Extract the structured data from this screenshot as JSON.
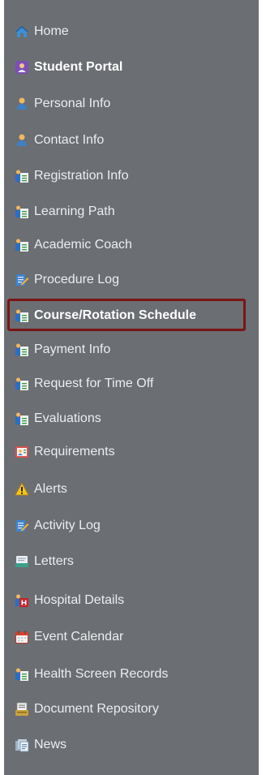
{
  "nav": {
    "items": [
      {
        "label": "Home",
        "icon": "home-icon"
      },
      {
        "label": "Student Portal",
        "icon": "student-portal-icon",
        "bold": true
      },
      {
        "label": "Personal Info",
        "icon": "person-icon"
      },
      {
        "label": "Contact Info",
        "icon": "person-icon"
      },
      {
        "label": "Registration Info",
        "icon": "clipboard-person-icon"
      },
      {
        "label": "Learning Path",
        "icon": "clipboard-person-icon"
      },
      {
        "label": "Academic Coach",
        "icon": "clipboard-person-icon"
      },
      {
        "label": "Procedure Log",
        "icon": "notepad-pencil-icon"
      },
      {
        "label": "Course/Rotation Schedule",
        "icon": "clipboard-person-icon",
        "bold": true,
        "selected": true
      },
      {
        "label": "Payment Info",
        "icon": "clipboard-person-icon"
      },
      {
        "label": "Request for Time Off",
        "icon": "clipboard-person-icon"
      },
      {
        "label": "Evaluations",
        "icon": "clipboard-person-icon"
      },
      {
        "label": "Requirements",
        "icon": "requirements-icon"
      },
      {
        "label": "Alerts",
        "icon": "warning-icon"
      },
      {
        "label": "Activity Log",
        "icon": "notepad-pencil-icon"
      },
      {
        "label": "Letters",
        "icon": "letter-icon"
      },
      {
        "label": "Hospital Details",
        "icon": "hospital-icon"
      },
      {
        "label": "Event Calendar",
        "icon": "calendar-icon"
      },
      {
        "label": "Health Screen Records",
        "icon": "clipboard-person-icon"
      },
      {
        "label": "Document Repository",
        "icon": "document-icon"
      },
      {
        "label": "News",
        "icon": "news-icon"
      }
    ]
  },
  "colors": {
    "sidebar_bg": "#6b6e72",
    "text": "#eceef0",
    "highlight_border": "#7a1515"
  }
}
